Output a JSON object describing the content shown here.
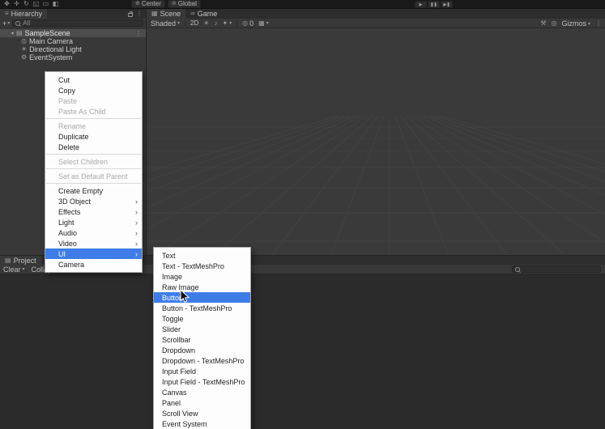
{
  "colors": {
    "accent": "#3e7de7"
  },
  "icons": {
    "caret": "▾",
    "kebab": "⋮",
    "foldout_open": "▾",
    "menu": "≡",
    "arrow": "›",
    "sun": "☀",
    "note": "♪",
    "sparkle": "✦",
    "grid": "▦",
    "lens": "◎",
    "gear": "⚙",
    "hammer": "⚒",
    "infinity": "∞",
    "scene_tab": "▦",
    "folder": "▤"
  },
  "top_toolbar": {
    "tools": [
      {
        "name": "hand-tool",
        "glyph": "✥"
      },
      {
        "name": "move-tool",
        "glyph": "✛"
      },
      {
        "name": "rotate-tool",
        "glyph": "↻"
      },
      {
        "name": "scale-tool",
        "glyph": "◱"
      },
      {
        "name": "rect-tool",
        "glyph": "▭"
      },
      {
        "name": "transform-tool",
        "glyph": "◧"
      }
    ],
    "pivot": {
      "label": "Center",
      "icon_glyph": "⊕"
    },
    "orientation": {
      "label": "Global",
      "icon_glyph": "⊚"
    },
    "play_controls": [
      {
        "name": "play-button",
        "glyph": "▶"
      },
      {
        "name": "pause-button",
        "glyph": "❚❚"
      },
      {
        "name": "step-button",
        "glyph": "▶❚"
      }
    ]
  },
  "hierarchy": {
    "title": "Hierarchy",
    "toolbar": {
      "create_label": "+",
      "search_label": "All"
    },
    "root": {
      "label": "SampleScene",
      "icon": "scene-icon",
      "glyph": "▤"
    },
    "children": [
      {
        "label": "Main Camera",
        "icon": "camera-icon",
        "glyph": "◎"
      },
      {
        "label": "Directional Light",
        "icon": "light-icon",
        "glyph": "☀"
      },
      {
        "label": "EventSystem",
        "icon": "eventsystem-icon",
        "glyph": "⚙"
      }
    ]
  },
  "scene_view": {
    "tabs": [
      {
        "label": "Scene",
        "active": true
      },
      {
        "label": "Game",
        "active": false
      }
    ],
    "draw_mode": "Shaded",
    "mode_2d": "2D",
    "visibility_count": "0",
    "gizmos_label": "Gizmos"
  },
  "bottom_panel": {
    "project_tab": "Project",
    "clear_label": "Clear",
    "collapse_label": "Collapse"
  },
  "context_menu": {
    "items": [
      {
        "label": "Cut",
        "enabled": true
      },
      {
        "label": "Copy",
        "enabled": true
      },
      {
        "label": "Paste",
        "enabled": false
      },
      {
        "label": "Paste As Child",
        "enabled": false
      },
      {
        "sep": true
      },
      {
        "label": "Rename",
        "enabled": false
      },
      {
        "label": "Duplicate",
        "enabled": true
      },
      {
        "label": "Delete",
        "enabled": true
      },
      {
        "sep": true
      },
      {
        "label": "Select Children",
        "enabled": false
      },
      {
        "sep": true
      },
      {
        "label": "Set as Default Parent",
        "enabled": false
      },
      {
        "sep": true
      },
      {
        "label": "Create Empty",
        "enabled": true
      },
      {
        "label": "3D Object",
        "enabled": true,
        "submenu": true
      },
      {
        "label": "Effects",
        "enabled": true,
        "submenu": true
      },
      {
        "label": "Light",
        "enabled": true,
        "submenu": true
      },
      {
        "label": "Audio",
        "enabled": true,
        "submenu": true
      },
      {
        "label": "Video",
        "enabled": true,
        "submenu": true
      },
      {
        "label": "UI",
        "enabled": true,
        "submenu": true,
        "highlighted": true
      },
      {
        "label": "Camera",
        "enabled": true
      }
    ]
  },
  "ui_submenu": {
    "highlighted_index": 4,
    "items": [
      "Text",
      "Text - TextMeshPro",
      "Image",
      "Raw Image",
      "Button",
      "Button - TextMeshPro",
      "Toggle",
      "Slider",
      "Scrollbar",
      "Dropdown",
      "Dropdown - TextMeshPro",
      "Input Field",
      "Input Field - TextMeshPro",
      "Canvas",
      "Panel",
      "Scroll View",
      "Event System"
    ]
  }
}
